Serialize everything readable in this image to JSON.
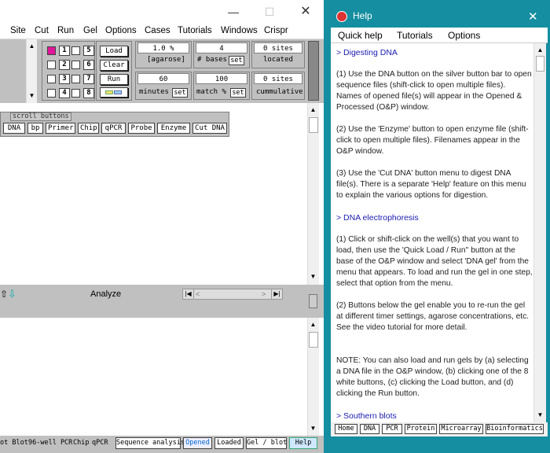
{
  "main": {
    "menu": [
      "Site",
      "Cut",
      "Run",
      "Gel",
      "Options",
      "Cases",
      "Tutorials",
      "Windows",
      "Crispr"
    ],
    "lanes": [
      "1",
      "5",
      "2",
      "6",
      "3",
      "7",
      "4",
      "8"
    ],
    "buttons": {
      "load": "Load",
      "clear": "Clear",
      "run": "Run"
    },
    "agarose": {
      "value": "1.0 %",
      "label": "[agarose]"
    },
    "bases": {
      "value": "4",
      "label": "# bases",
      "set": "set"
    },
    "sites1": {
      "value": "0 sites",
      "label": "located"
    },
    "minutes": {
      "value": "60",
      "label": "minutes",
      "set": "set"
    },
    "match": {
      "value": "100",
      "label": "match %",
      "set": "set"
    },
    "sites2": {
      "value": "0 sites",
      "label": "cummulative"
    },
    "scroll_buttons_label": "scroll buttons",
    "scroll_buttons": [
      "DNA",
      "bp",
      "Primer",
      "Chip",
      "qPCR",
      "Probe",
      "Enzyme",
      "Cut DNA"
    ],
    "analyze": "Analyze",
    "bottom": {
      "dot_blot": "ot Blot",
      "well96": "96-well PCR",
      "chip": "Chip",
      "qpcr": "qPCR",
      "sequence": "Sequence analysis",
      "opened": "Opened",
      "loaded": "Loaded",
      "gelblot": "Gel / blot",
      "help": "Help"
    }
  },
  "help": {
    "title": "Help",
    "menu": [
      "Quick help",
      "Tutorials",
      "Options"
    ],
    "sections": [
      {
        "heading": "> Digesting DNA"
      },
      {
        "text": "(1) Use the DNA button on the silver button bar to open sequence files (shift-click to open multiple files). Names of opened file(s) will appear in the Opened & Processed (O&P) window."
      },
      {
        "text": "(2) Use the 'Enzyme' button to open enzyme file (shift-click to open multiple files). Filenames appear in the O&P window."
      },
      {
        "text": "(3) Use the 'Cut DNA' button menu to digest DNA file(s).  There is a separate 'Help' feature on this menu to explain the various options for digestion."
      },
      {
        "heading": "> DNA electrophoresis"
      },
      {
        "text": "(1) Click or shift-click on the well(s) that you want to load, then use the 'Quick Load / Run'' button at the base of the O&P window and select 'DNA gel' from the menu that appears. To load and run the gel in one step, select that option from the menu."
      },
      {
        "text": "(2) Buttons below the gel enable you to re-run the gel at different timer settings, agarose concentrations, etc. See the video tutorial for more detail."
      },
      {
        "text": "NOTE: You can also load and run gels by (a) selecting a DNA file in the O&P window, (b) clicking one of the 8 white buttons, (c) clicking the Load button, and (d) clicking the Run button."
      },
      {
        "heading": "> Southern blots"
      }
    ],
    "bottom": [
      "Home",
      "DNA",
      "PCR",
      "Protein",
      "Microarray",
      "Bioinformatics"
    ]
  },
  "colors": {
    "teal": "#148ea0",
    "silver": "#c0c0c0",
    "link": "#1a1ab0"
  }
}
